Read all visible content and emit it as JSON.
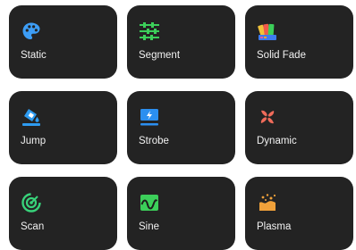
{
  "modes": [
    {
      "label": "Static",
      "icon": "palette-icon"
    },
    {
      "label": "Segment",
      "icon": "segment-sliders-icon"
    },
    {
      "label": "Solid Fade",
      "icon": "color-swatches-icon"
    },
    {
      "label": "Jump",
      "icon": "jump-bucket-icon"
    },
    {
      "label": "Strobe",
      "icon": "strobe-flash-icon"
    },
    {
      "label": "Dynamic",
      "icon": "pinwheel-icon"
    },
    {
      "label": "Scan",
      "icon": "scan-radar-icon"
    },
    {
      "label": "Sine",
      "icon": "sine-wave-icon"
    },
    {
      "label": "Plasma",
      "icon": "plasma-sparkle-icon"
    }
  ],
  "colors": {
    "tile_background": "#232323",
    "label_text": "#f2f2f2",
    "palette_blue": "#3d9df5",
    "segment_green": "#3ccf5a",
    "jump_blue": "#2e9bf0",
    "strobe_blue": "#2b8ff0",
    "dynamic_coral": "#f06b5a",
    "scan_green": "#38d27a",
    "sine_green": "#3ccf5a",
    "plasma_orange": "#f0a13a"
  }
}
